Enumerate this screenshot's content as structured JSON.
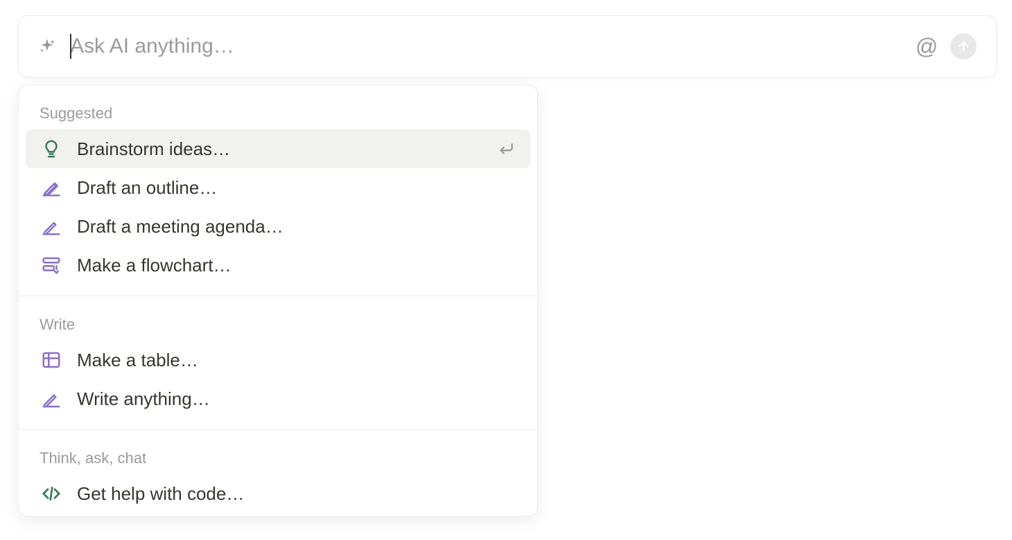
{
  "input": {
    "placeholder": "Ask AI anything…",
    "value": ""
  },
  "sections": [
    {
      "header": "Suggested",
      "items": [
        {
          "label": "Brainstorm ideas…",
          "icon": "lightbulb",
          "highlighted": true
        },
        {
          "label": "Draft an outline…",
          "icon": "pencil",
          "highlighted": false
        },
        {
          "label": "Draft a meeting agenda…",
          "icon": "pencil",
          "highlighted": false
        },
        {
          "label": "Make a flowchart…",
          "icon": "flowchart",
          "highlighted": false
        }
      ]
    },
    {
      "header": "Write",
      "items": [
        {
          "label": "Make a table…",
          "icon": "table",
          "highlighted": false
        },
        {
          "label": "Write anything…",
          "icon": "pencil",
          "highlighted": false
        }
      ]
    },
    {
      "header": "Think, ask, chat",
      "items": [
        {
          "label": "Get help with code…",
          "icon": "code",
          "highlighted": false
        }
      ]
    }
  ],
  "colors": {
    "iconPurple": "#8a6fc9",
    "iconGreen": "#3a7a5a"
  }
}
